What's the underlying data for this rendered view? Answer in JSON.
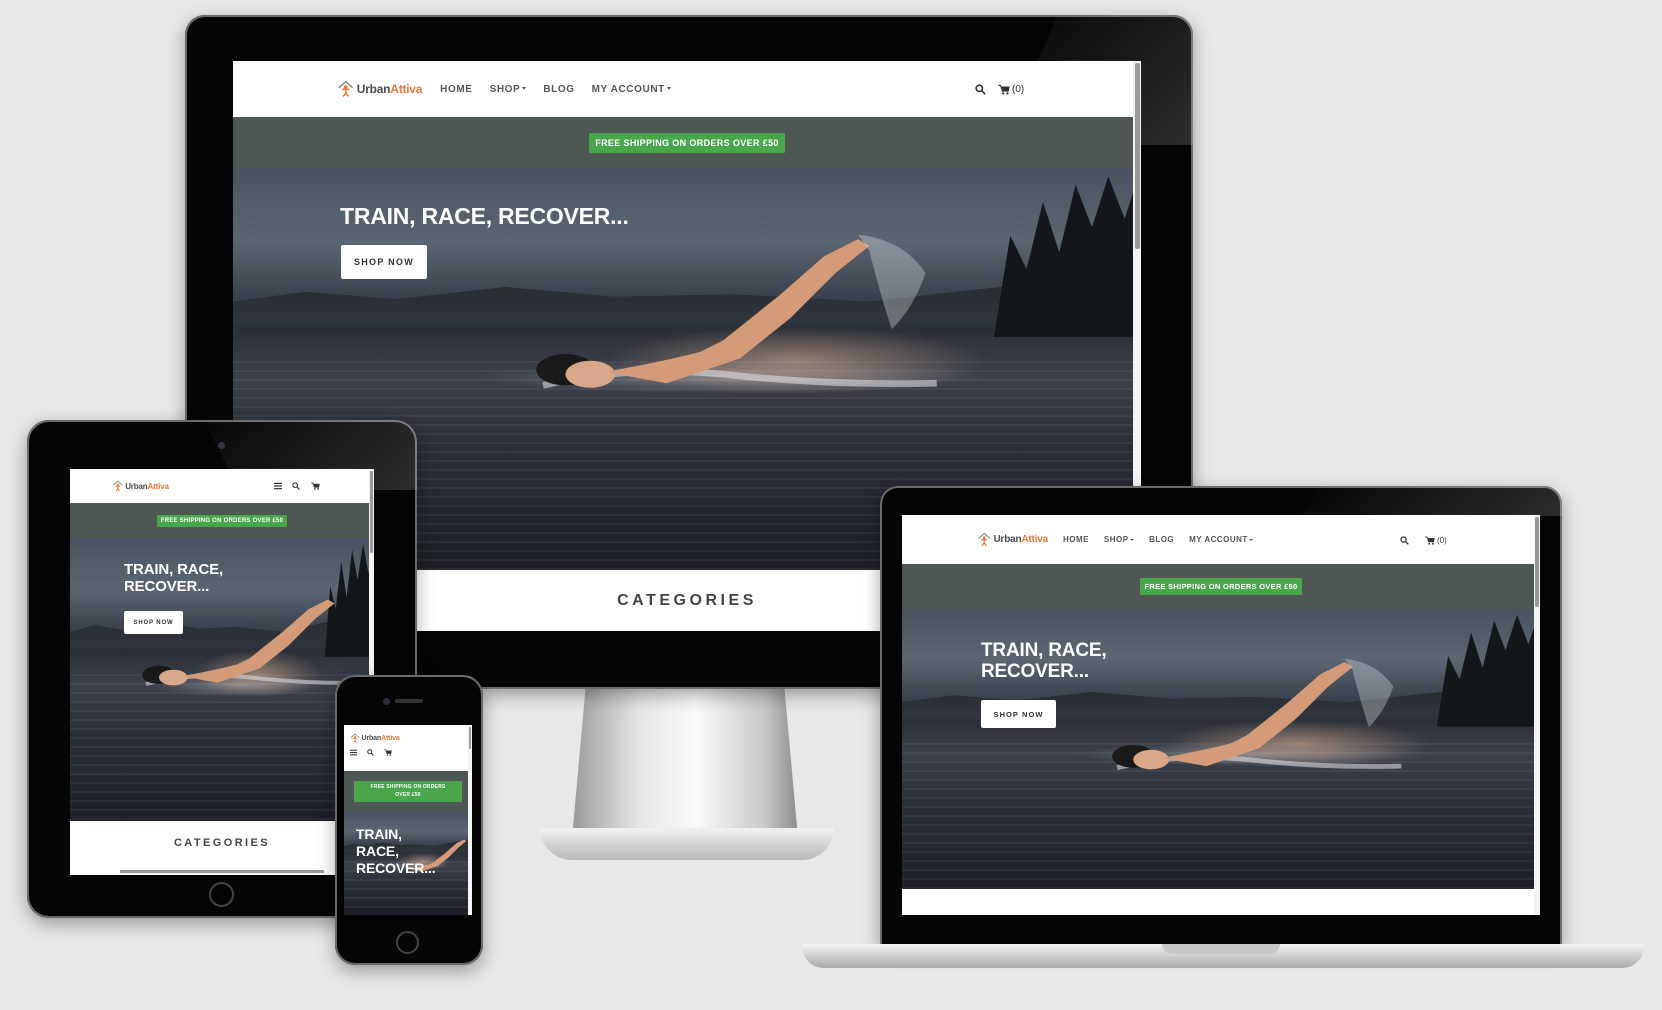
{
  "site": {
    "logo_urban": "Urban",
    "logo_attiva": "Attiva",
    "nav": {
      "home": "HOME",
      "shop": "SHOP",
      "blog": "BLOG",
      "account": "MY ACCOUNT",
      "cart_count": "(0)"
    },
    "promo": "FREE SHIPPING ON ORDERS OVER £50",
    "promo_line1": "FREE SHIPPING ON ORDERS",
    "promo_line2": "OVER £50",
    "hero_title": "TRAIN, RACE, RECOVER...",
    "hero_title_line1": "TRAIN, RACE,",
    "hero_title_line2": "RECOVER...",
    "mobile_title_line1": "TRAIN,",
    "mobile_title_line2": "RACE,",
    "mobile_title_line3": "RECOVER...",
    "shop_now": "SHOP NOW",
    "categories": "CATEGORIES"
  },
  "colors": {
    "background": "#e8e8e8",
    "promo_bar": "#4e5754",
    "promo_pill": "#4aa64b",
    "logo_accent": "#e8773a"
  },
  "icons": [
    "search-icon",
    "cart-icon",
    "hamburger-icon",
    "logo-icon",
    "caret-down-icon"
  ]
}
